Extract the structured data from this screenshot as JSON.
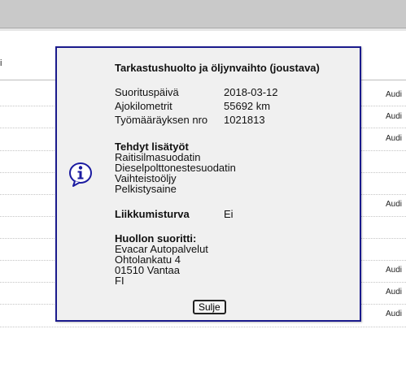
{
  "background": {
    "header_fragment": "i",
    "row_label": "Audi"
  },
  "dialog": {
    "title": "Tarkastushuolto ja öljynvaihto (joustava)",
    "icon": "info-icon",
    "fields": [
      {
        "label": "Suorituspäivä",
        "value": "2018-03-12"
      },
      {
        "label": "Ajokilometrit",
        "value": "55692 km"
      },
      {
        "label": "Työmääräyksen nro",
        "value": "1021813"
      }
    ],
    "extra_work": {
      "title": "Tehdyt lisätyöt",
      "items": [
        "Raitisilmasuodatin",
        "Dieselpolttonestesuodatin",
        "Vaihteistoöljy",
        "Pelkistysaine"
      ]
    },
    "mobility": {
      "label": "Liikkumisturva",
      "value": "Ei"
    },
    "provider": {
      "title": "Huollon suoritti:",
      "lines": [
        "Evacar Autopalvelut",
        "Ohtolankatu 4",
        "01510 Vantaa",
        "FI"
      ]
    },
    "close_label": "Sulje"
  },
  "colors": {
    "dialog_border": "#1a1a8c",
    "dialog_bg": "#f0f0f0",
    "topbar": "#c9c9c9",
    "icon_blue": "#1a1aa0"
  }
}
